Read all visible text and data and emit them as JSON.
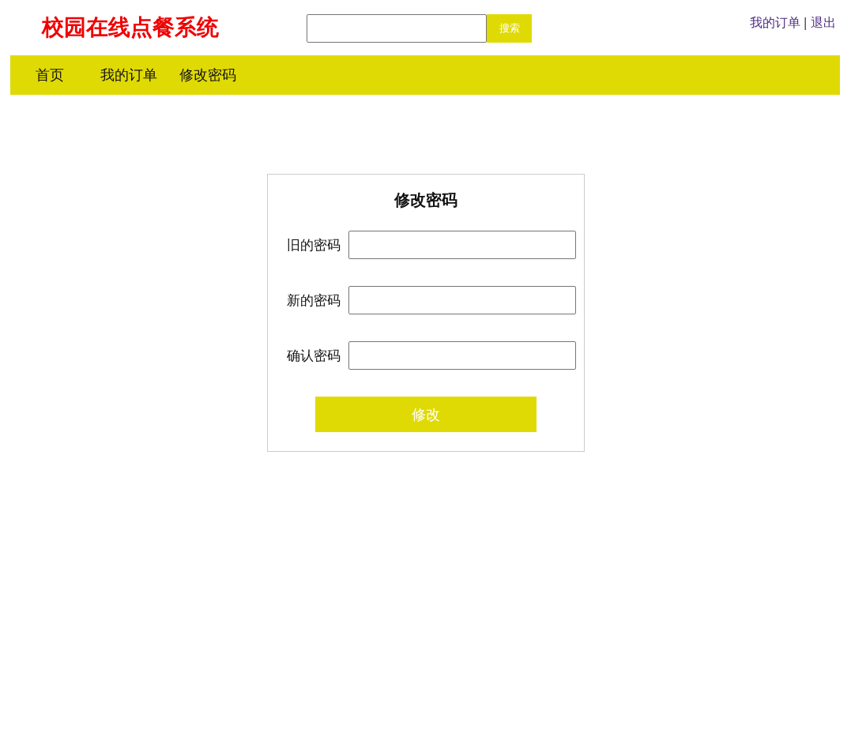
{
  "header": {
    "title": "校园在线点餐系统",
    "search": {
      "button": "搜索"
    },
    "user_links": [
      {
        "label": "我的订单"
      },
      {
        "label": "退出"
      }
    ],
    "separator": "|"
  },
  "nav": {
    "items": [
      {
        "label": "首页"
      },
      {
        "label": "我的订单"
      },
      {
        "label": "修改密码"
      }
    ]
  },
  "form": {
    "title": "修改密码",
    "fields": [
      {
        "label": "旧的密码"
      },
      {
        "label": "新的密码"
      },
      {
        "label": "确认密码"
      }
    ],
    "submit": "修改"
  }
}
